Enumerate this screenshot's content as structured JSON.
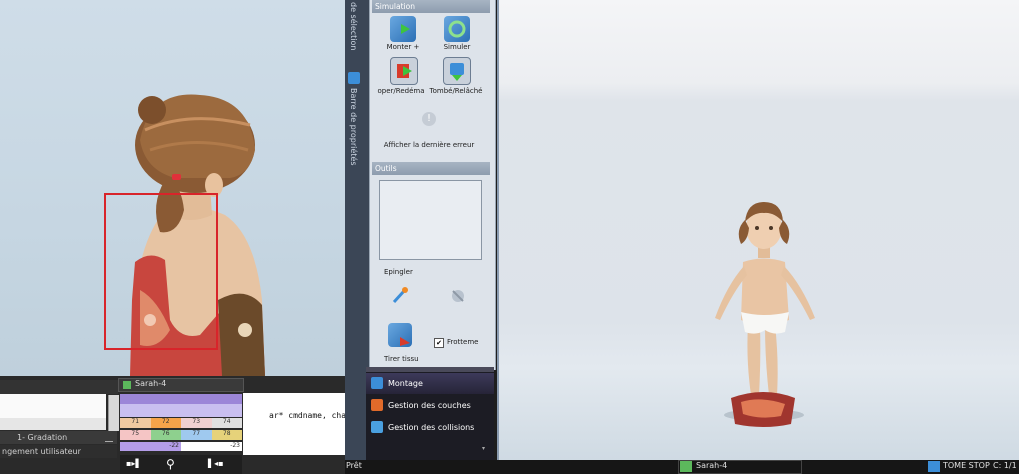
{
  "left_panel": {
    "tab_label": "Sarah-4",
    "rows": [
      "1- Gradation",
      "ngement utilisateur"
    ],
    "code_text": "ar* cmdname, char* d",
    "track_numbers": [
      "71",
      "72",
      "73",
      "74",
      "75",
      "76",
      "77",
      "78",
      "-22",
      "-23"
    ]
  },
  "vertical_strip": {
    "label_top": "de sélection",
    "label_props": "Barre de propriétés"
  },
  "simulation": {
    "header": "Simulation",
    "monter_label": "Monter +",
    "simuler_label": "Simuler",
    "stopper_label": "oper/Redéma",
    "tombe_label": "Tombé/Relâché",
    "error_label": "Afficher la dernière erreur"
  },
  "outils": {
    "header": "Outils",
    "epingler_label": "Epingler",
    "frotteme_label": "Frotteme",
    "frotteme_checked": true,
    "tirer_label": "Tirer tissu"
  },
  "nav": {
    "items": [
      "Montage",
      "Gestion des couches",
      "Gestion des collisions"
    ]
  },
  "statusbar": {
    "ready": "Prêt",
    "avatar_name": "Sarah-4",
    "tome_stop": "TOME STOP",
    "counter": "C: 1/1"
  },
  "colors": {
    "selection_rect": "#d8242a",
    "accent_blue": "#3c8ed8"
  }
}
